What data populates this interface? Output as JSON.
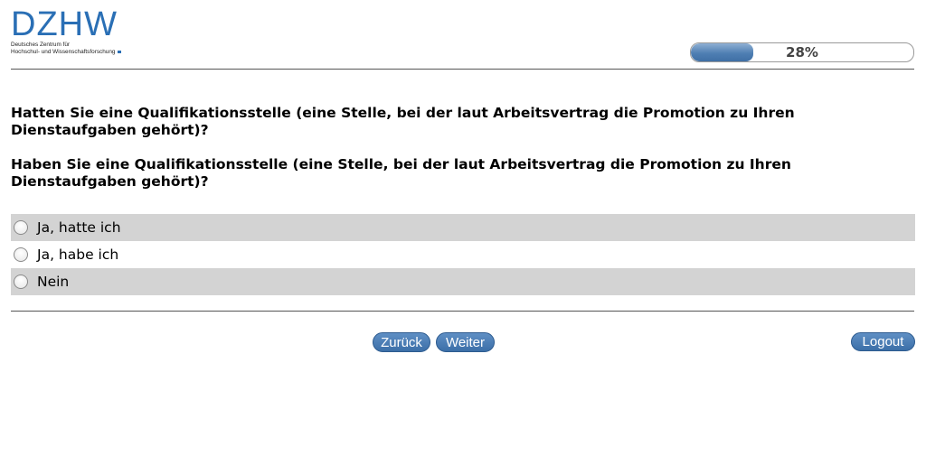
{
  "logo": {
    "mark": "DZHW",
    "line1": "Deutsches Zentrum für",
    "line2": "Hochschul- und Wissenschaftsforschung"
  },
  "progress": {
    "value": 0.28,
    "label": "28%"
  },
  "questions": [
    "Hatten Sie eine Qualifikationsstelle (eine Stelle, bei der laut Arbeitsvertrag die Promotion zu Ihren Dienstaufgaben gehört)?",
    "Haben Sie eine Qualifikationsstelle (eine Stelle, bei der laut Arbeitsvertrag die Promotion zu Ihren Dienstaufgaben gehört)?"
  ],
  "options": [
    {
      "label": "Ja, hatte ich"
    },
    {
      "label": "Ja, habe ich"
    },
    {
      "label": "Nein"
    }
  ],
  "buttons": {
    "back": "Zurück",
    "next": "Weiter",
    "logout": "Logout"
  },
  "colors": {
    "accent": "#3c6fa8",
    "logo": "#2a6fb5",
    "row_shade": "#d3d3d3"
  }
}
